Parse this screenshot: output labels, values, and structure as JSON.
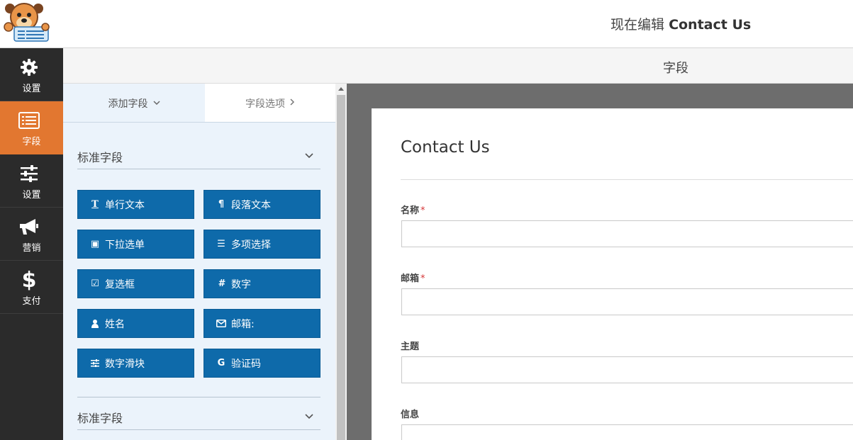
{
  "header": {
    "editing_prefix": "现在编辑",
    "form_name": "Contact Us"
  },
  "sidebar": {
    "items": [
      {
        "label": "设置",
        "icon": "gear-icon"
      },
      {
        "label": "字段",
        "icon": "list-icon",
        "active": true
      },
      {
        "label": "设置",
        "icon": "sliders-icon"
      },
      {
        "label": "营销",
        "icon": "megaphone-icon"
      },
      {
        "label": "支付",
        "icon": "dollar-icon"
      }
    ]
  },
  "section": {
    "title": "字段"
  },
  "panel": {
    "tabs": {
      "add_fields": "添加字段",
      "field_options": "字段选项"
    },
    "groups": [
      {
        "title": "标准字段",
        "fields": [
          {
            "label": "单行文本",
            "icon": "T"
          },
          {
            "label": "段落文本",
            "icon": "¶"
          },
          {
            "label": "下拉选单",
            "icon": "▣"
          },
          {
            "label": "多项选择",
            "icon": "☰"
          },
          {
            "label": "复选框",
            "icon": "☑"
          },
          {
            "label": "数字",
            "icon": "#"
          },
          {
            "label": "姓名",
            "icon": "●"
          },
          {
            "label": "邮箱:",
            "icon": "✉"
          },
          {
            "label": "数字滑块",
            "icon": "⚟"
          },
          {
            "label": "验证码",
            "icon": "G"
          }
        ]
      },
      {
        "title": "标准字段"
      }
    ]
  },
  "form": {
    "title": "Contact Us",
    "fields": [
      {
        "label": "名称",
        "required_mark": "*"
      },
      {
        "label": "邮箱",
        "required_mark": "*"
      },
      {
        "label": "主题",
        "required_mark": ""
      },
      {
        "label": "信息",
        "required_mark": ""
      }
    ]
  },
  "colors": {
    "accent": "#e27730",
    "button": "#0e6aaa",
    "sidebar_bg": "#2b2b2b",
    "panel_bg": "#ebf3fb",
    "preview_bg": "#6d6d6d"
  }
}
